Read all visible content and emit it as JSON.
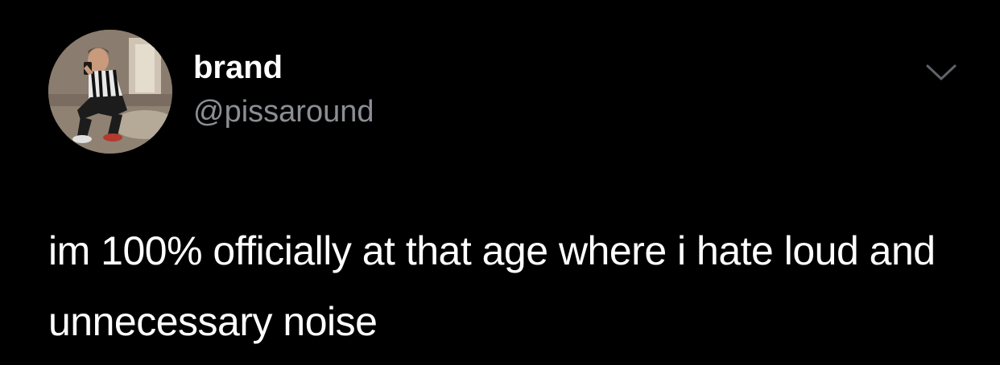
{
  "tweet": {
    "author": {
      "display_name": "brand",
      "handle": "@pissaround",
      "avatar_icon": "profile-photo"
    },
    "menu_icon": "chevron-down-icon",
    "text": "im 100% officially at that age where i hate loud and unnecessary noise"
  },
  "colors": {
    "background": "#000000",
    "text_primary": "#ffffff",
    "text_secondary": "#8b8f94"
  }
}
